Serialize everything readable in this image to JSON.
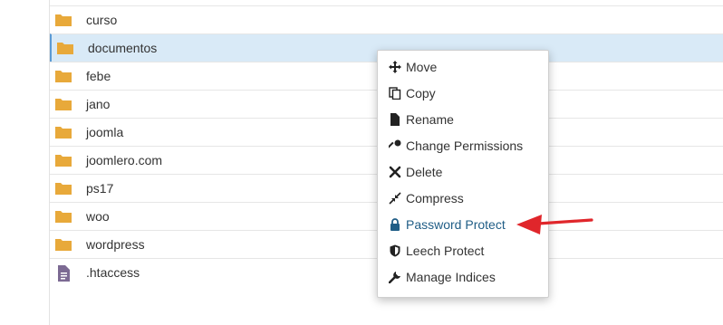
{
  "file_list": {
    "items": [
      {
        "name": "curso",
        "type": "folder"
      },
      {
        "name": "documentos",
        "type": "folder",
        "selected": true
      },
      {
        "name": "febe",
        "type": "folder"
      },
      {
        "name": "jano",
        "type": "folder"
      },
      {
        "name": "joomla",
        "type": "folder"
      },
      {
        "name": "joomlero.com",
        "type": "folder"
      },
      {
        "name": "ps17",
        "type": "folder"
      },
      {
        "name": "woo",
        "type": "folder"
      },
      {
        "name": "wordpress",
        "type": "folder"
      },
      {
        "name": ".htaccess",
        "type": "file"
      }
    ]
  },
  "context_menu": {
    "items": [
      {
        "label": "Move",
        "icon": "move-icon"
      },
      {
        "label": "Copy",
        "icon": "copy-icon"
      },
      {
        "label": "Rename",
        "icon": "file-icon"
      },
      {
        "label": "Change Permissions",
        "icon": "key-icon"
      },
      {
        "label": "Delete",
        "icon": "close-icon"
      },
      {
        "label": "Compress",
        "icon": "compress-icon"
      },
      {
        "label": "Password Protect",
        "icon": "lock-icon",
        "highlighted": true
      },
      {
        "label": "Leech Protect",
        "icon": "shield-icon"
      },
      {
        "label": "Manage Indices",
        "icon": "wrench-icon"
      }
    ]
  },
  "colors": {
    "folder": "#e8a93a",
    "file": "#7c6a93",
    "selected_row": "#d9eaf7",
    "highlight_text": "#1f5d86",
    "arrow": "#e0262b"
  }
}
